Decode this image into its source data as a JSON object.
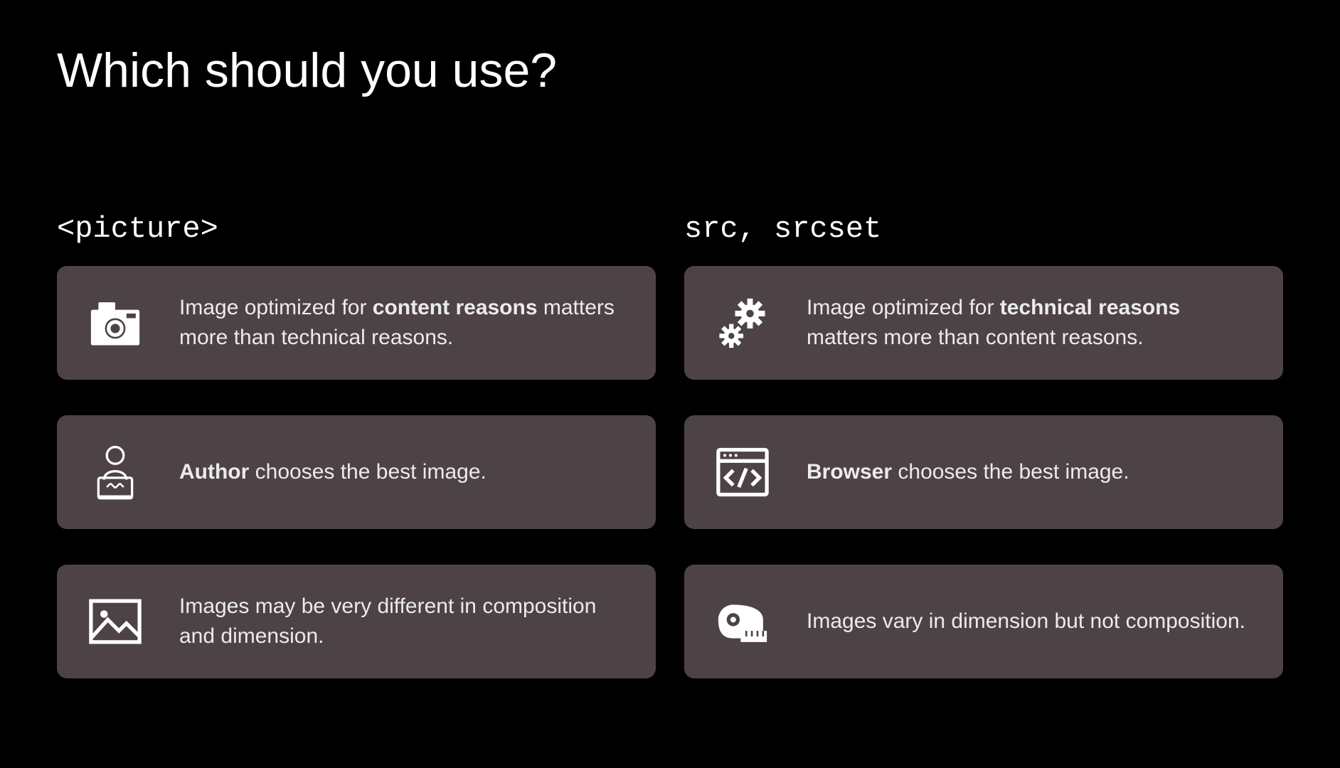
{
  "slide": {
    "title": "Which should you use?"
  },
  "left": {
    "heading": "<picture>",
    "cards": [
      {
        "icon": "camera-icon",
        "prefix": "Image optimized for ",
        "bold": "content reasons",
        "suffix": " matters more than technical reasons."
      },
      {
        "icon": "author-icon",
        "prefix": "",
        "bold": "Author",
        "suffix": " chooses the best image."
      },
      {
        "icon": "picture-icon",
        "prefix": "Images may be very different in composition and dimension.",
        "bold": "",
        "suffix": ""
      }
    ]
  },
  "right": {
    "heading": "src, srcset",
    "cards": [
      {
        "icon": "gears-icon",
        "prefix": "Image optimized for ",
        "bold": "technical reasons",
        "suffix": " matters more than content reasons."
      },
      {
        "icon": "browser-icon",
        "prefix": "",
        "bold": "Browser",
        "suffix": " chooses the best image."
      },
      {
        "icon": "tape-measure-icon",
        "prefix": "Images vary in dimension but not composition.",
        "bold": "",
        "suffix": ""
      }
    ]
  }
}
